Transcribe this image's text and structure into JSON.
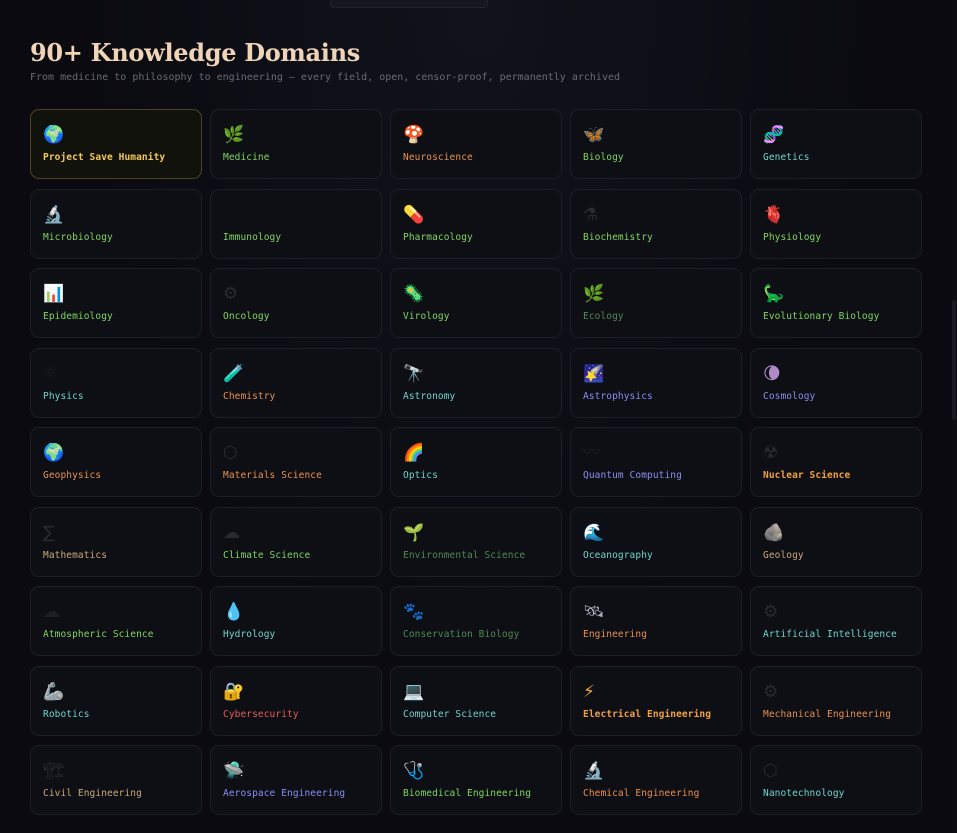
{
  "header": {
    "title": "90+ Knowledge Domains",
    "subtitle": "From medicine to philosophy to engineering — every field, open, censor-proof, permanently archived"
  },
  "domains": [
    {
      "label": "Project Save Humanity",
      "icon_name": "globe-icon",
      "glyph": "🌍",
      "icon_color": "#4aa3e0",
      "color": "#f2c85a"
    },
    {
      "label": "Medicine",
      "icon_name": "herb-icon",
      "glyph": "🌿",
      "icon_color": "#7acb5a",
      "color": "#7fd660"
    },
    {
      "label": "Neuroscience",
      "icon_name": "mushroom-icon",
      "glyph": "🍄",
      "icon_color": "#e25555",
      "color": "#e8914e"
    },
    {
      "label": "Biology",
      "icon_name": "butterfly-icon",
      "glyph": "🦋",
      "icon_color": "#e0507a",
      "color": "#7fd660"
    },
    {
      "label": "Genetics",
      "icon_name": "dna-icon",
      "glyph": "🧬",
      "icon_color": "#d65fa0",
      "color": "#6fd4c8"
    },
    {
      "label": "Microbiology",
      "icon_name": "microscope-icon",
      "glyph": "🔬",
      "icon_color": "#b8b8d0",
      "color": "#7fd660"
    },
    {
      "label": "Immunology",
      "icon_name": "shield-icon",
      "glyph": "",
      "icon_color": "#2a2a33",
      "color": "#7fd660"
    },
    {
      "label": "Pharmacology",
      "icon_name": "pill-icon",
      "glyph": "💊",
      "icon_color": "#e85c5c",
      "color": "#7fd660"
    },
    {
      "label": "Biochemistry",
      "icon_name": "flask-icon",
      "glyph": "⚗",
      "icon_color": "#2a2a33",
      "color": "#7fd660"
    },
    {
      "label": "Physiology",
      "icon_name": "anatomical-heart-icon",
      "glyph": "🫀",
      "icon_color": "#e0506a",
      "color": "#7fd660"
    },
    {
      "label": "Epidemiology",
      "icon_name": "bar-chart-icon",
      "glyph": "📊",
      "icon_color": "#5aa0e0",
      "color": "#7fd660"
    },
    {
      "label": "Oncology",
      "icon_name": "gear-icon",
      "glyph": "⚙",
      "icon_color": "#2a2a33",
      "color": "#7fd660"
    },
    {
      "label": "Virology",
      "icon_name": "microbe-icon",
      "glyph": "🦠",
      "icon_color": "#5cd05c",
      "color": "#7fd660"
    },
    {
      "label": "Ecology",
      "icon_name": "herb-icon",
      "glyph": "🌿",
      "icon_color": "#7acb5a",
      "color": "#4f8a52"
    },
    {
      "label": "Evolutionary Biology",
      "icon_name": "dinosaur-icon",
      "glyph": "🦕",
      "icon_color": "#3fb89a",
      "color": "#7fd660"
    },
    {
      "label": "Physics",
      "icon_name": "atom-icon",
      "glyph": "⚛",
      "icon_color": "#1e1e26",
      "color": "#6fd4c8"
    },
    {
      "label": "Chemistry",
      "icon_name": "test-tube-icon",
      "glyph": "🧪",
      "icon_color": "#6fd060",
      "color": "#e8914e"
    },
    {
      "label": "Astronomy",
      "icon_name": "telescope-icon",
      "glyph": "🔭",
      "icon_color": "#c8c8e0",
      "color": "#6fd4c8"
    },
    {
      "label": "Astrophysics",
      "icon_name": "shooting-star-icon",
      "glyph": "🌠",
      "icon_color": "#5a78c8",
      "color": "#8a8ef0"
    },
    {
      "label": "Cosmology",
      "icon_name": "moon-icon",
      "glyph": "🌘",
      "icon_color": "#b08ac8",
      "color": "#8a8ef0"
    },
    {
      "label": "Geophysics",
      "icon_name": "globe-icon",
      "glyph": "🌍",
      "icon_color": "#4aa3e0",
      "color": "#e8914e"
    },
    {
      "label": "Materials Science",
      "icon_name": "hexagon-icon",
      "glyph": "⬡",
      "icon_color": "#2a2a33",
      "color": "#e8914e"
    },
    {
      "label": "Optics",
      "icon_name": "rainbow-icon",
      "glyph": "🌈",
      "icon_color": "#e0a050",
      "color": "#6fd4c8"
    },
    {
      "label": "Quantum Computing",
      "icon_name": "wave-icon",
      "glyph": "〰",
      "icon_color": "#1e1e26",
      "color": "#8a8ef0"
    },
    {
      "label": "Nuclear Science",
      "icon_name": "radioactive-icon",
      "glyph": "☢",
      "icon_color": "#2a2a33",
      "color": "#f0a040"
    },
    {
      "label": "Mathematics",
      "icon_name": "sigma-icon",
      "glyph": "∑",
      "icon_color": "#2a2a33",
      "color": "#c8aa7a"
    },
    {
      "label": "Climate Science",
      "icon_name": "cloud-icon",
      "glyph": "☁",
      "icon_color": "#2a2a33",
      "color": "#7fd660"
    },
    {
      "label": "Environmental Science",
      "icon_name": "seedling-icon",
      "glyph": "🌱",
      "icon_color": "#6fd060",
      "color": "#4f8a52"
    },
    {
      "label": "Oceanography",
      "icon_name": "ocean-wave-icon",
      "glyph": "🌊",
      "icon_color": "#4a90e0",
      "color": "#6fd4c8"
    },
    {
      "label": "Geology",
      "icon_name": "rock-icon",
      "glyph": "🪨",
      "icon_color": "#e8e8ec",
      "color": "#c8aa7a"
    },
    {
      "label": "Atmospheric Science",
      "icon_name": "cloud-icon",
      "glyph": "☁",
      "icon_color": "#1e1e26",
      "color": "#7fd660"
    },
    {
      "label": "Hydrology",
      "icon_name": "droplet-icon",
      "glyph": "💧",
      "icon_color": "#5ab0f0",
      "color": "#6fd4c8"
    },
    {
      "label": "Conservation Biology",
      "icon_name": "paw-icon",
      "glyph": "🐾",
      "icon_color": "#2a2a33",
      "color": "#4f8a52"
    },
    {
      "label": "Engineering",
      "icon_name": "satellite-icon",
      "glyph": "🛰",
      "icon_color": "#b0b0c0",
      "color": "#e8914e"
    },
    {
      "label": "Artificial Intelligence",
      "icon_name": "gear-icon",
      "glyph": "⚙",
      "icon_color": "#2a2a33",
      "color": "#6fd4c8"
    },
    {
      "label": "Robotics",
      "icon_name": "mechanical-arm-icon",
      "glyph": "🦾",
      "icon_color": "#b0b0c0",
      "color": "#6fd4c8"
    },
    {
      "label": "Cybersecurity",
      "icon_name": "lock-icon",
      "glyph": "🔐",
      "icon_color": "#e0b040",
      "color": "#e85c5c"
    },
    {
      "label": "Computer Science",
      "icon_name": "laptop-icon",
      "glyph": "💻",
      "icon_color": "#6090d0",
      "color": "#6fd4c8"
    },
    {
      "label": "Electrical Engineering",
      "icon_name": "lightning-icon",
      "glyph": "⚡",
      "icon_color": "#f0a030",
      "color": "#f0a040"
    },
    {
      "label": "Mechanical Engineering",
      "icon_name": "gear-icon",
      "glyph": "⚙",
      "icon_color": "#2a2a33",
      "color": "#e8914e"
    },
    {
      "label": "Civil Engineering",
      "icon_name": "building-icon",
      "glyph": "🏗",
      "icon_color": "#2a2a33",
      "color": "#c8aa7a"
    },
    {
      "label": "Aerospace Engineering",
      "icon_name": "flying-saucer-icon",
      "glyph": "🛸",
      "icon_color": "#7acb5a",
      "color": "#8a8ef0"
    },
    {
      "label": "Biomedical Engineering",
      "icon_name": "stethoscope-icon",
      "glyph": "🩺",
      "icon_color": "#6080e0",
      "color": "#7fd660"
    },
    {
      "label": "Chemical Engineering",
      "icon_name": "microscope-icon",
      "glyph": "🔬",
      "icon_color": "#b8b8d0",
      "color": "#e8914e"
    },
    {
      "label": "Nanotechnology",
      "icon_name": "hexagon-icon",
      "glyph": "⬡",
      "icon_color": "#2a2a33",
      "color": "#6fd4c8"
    }
  ]
}
